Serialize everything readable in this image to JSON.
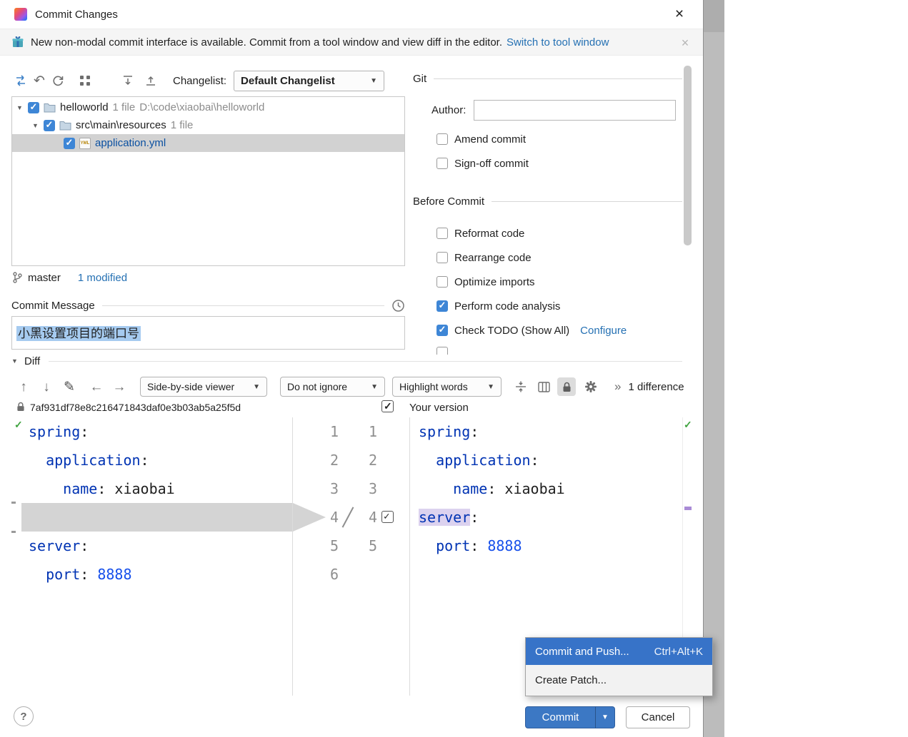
{
  "colors": {
    "accent_blue": "#3C78C4",
    "selection_blue": "#A6CBF0",
    "link_blue": "#2470B3",
    "checkbox_blue": "#3E86D6",
    "modified_file_blue": "#0A50A1",
    "yaml_key": "#0033B3",
    "number_literal": "#1750EB",
    "removed_row_gray": "#D4D4D4",
    "word_highlight_purple": "#DCD2EF",
    "popup_selection": "#3773C8"
  },
  "window": {
    "title": "Commit Changes",
    "close_glyph": "×"
  },
  "banner": {
    "message": "New non-modal commit interface is available. Commit from a tool window and view diff in the editor.",
    "link_label": "Switch to tool window",
    "close_glyph": "×"
  },
  "toolbar": {
    "changelist_label": "Changelist:",
    "changelist_value": "Default Changelist",
    "dropdown_arrow": "▼",
    "revert_glyph": "↶"
  },
  "file_tree": {
    "root": {
      "name": "helloworld",
      "meta": "1 file",
      "path": "D:\\code\\xiaobai\\helloworld",
      "checked": true,
      "twisty": "▼"
    },
    "folder": {
      "name": "src\\main\\resources",
      "meta": "1 file",
      "checked": true,
      "twisty": "▼"
    },
    "file": {
      "name": "application.yml",
      "type": "YML",
      "checked": true
    }
  },
  "vcs_bar": {
    "branch": "master",
    "modified": "1 modified"
  },
  "commit_message": {
    "label": "Commit Message",
    "text": "小黑设置项目的端口号"
  },
  "git_options": {
    "title": "Git",
    "author_label": "Author:",
    "author_value": "",
    "amend": {
      "label": "Amend commit",
      "checked": false
    },
    "signoff": {
      "label": "Sign-off commit",
      "checked": false
    }
  },
  "before_commit": {
    "title": "Before Commit",
    "items": [
      {
        "label": "Reformat code",
        "checked": false
      },
      {
        "label": "Rearrange code",
        "checked": false
      },
      {
        "label": "Optimize imports",
        "checked": false
      },
      {
        "label": "Perform code analysis",
        "checked": true
      },
      {
        "label": "Check TODO (Show All)",
        "checked": true,
        "link": "Configure"
      }
    ]
  },
  "diff": {
    "section_label": "Diff",
    "section_twisty": "▼",
    "nav_up_glyph": "↑",
    "nav_down_glyph": "↓",
    "edit_glyph": "✎",
    "back_glyph": "←",
    "forward_glyph": "→",
    "viewer_select": "Side-by-side viewer",
    "ignore_select": "Do not ignore",
    "highlight_select": "Highlight words",
    "overflow_glyph": "»",
    "difference_count": "1 difference",
    "left_revision": "7af931df78e8c216471843daf0e3b03ab5a25f5d",
    "right_title": "Your version",
    "no_problems_glyph": "✓",
    "left_lines": [
      {
        "tokens": [
          {
            "text": "spring",
            "cls": "key"
          },
          {
            "text": ":",
            "cls": "plain"
          }
        ]
      },
      {
        "tokens": [
          {
            "text": "  application",
            "cls": "key"
          },
          {
            "text": ":",
            "cls": "plain"
          }
        ]
      },
      {
        "tokens": [
          {
            "text": "    name",
            "cls": "key"
          },
          {
            "text": ": ",
            "cls": "plain"
          },
          {
            "text": "xiaobai",
            "cls": "plain"
          }
        ]
      },
      {
        "gap": true,
        "tokens": []
      },
      {
        "tokens": [
          {
            "text": "server",
            "cls": "key"
          },
          {
            "text": ":",
            "cls": "plain"
          }
        ]
      },
      {
        "tokens": [
          {
            "text": "  port",
            "cls": "key"
          },
          {
            "text": ": ",
            "cls": "plain"
          },
          {
            "text": "8888",
            "cls": "num"
          }
        ]
      }
    ],
    "right_lines": [
      {
        "tokens": [
          {
            "text": "spring",
            "cls": "key"
          },
          {
            "text": ":",
            "cls": "plain"
          }
        ]
      },
      {
        "tokens": [
          {
            "text": "  application",
            "cls": "key"
          },
          {
            "text": ":",
            "cls": "plain"
          }
        ]
      },
      {
        "tokens": [
          {
            "text": "    name",
            "cls": "key"
          },
          {
            "text": ": ",
            "cls": "plain"
          },
          {
            "text": "xiaobai",
            "cls": "plain"
          }
        ]
      },
      {
        "tokens": [
          {
            "text": "server",
            "cls": "key",
            "hl": true
          },
          {
            "text": ":",
            "cls": "plain"
          }
        ]
      },
      {
        "tokens": [
          {
            "text": "  port",
            "cls": "key"
          },
          {
            "text": ": ",
            "cls": "plain"
          },
          {
            "text": "8888",
            "cls": "num"
          }
        ]
      }
    ],
    "gutter": [
      {
        "left": "1",
        "right": "1"
      },
      {
        "left": "2",
        "right": "2"
      },
      {
        "left": "3",
        "right": "3"
      },
      {
        "left": "4",
        "right": "4",
        "checkbox": true,
        "slash": true
      },
      {
        "left": "5",
        "right": "5"
      },
      {
        "left": "6",
        "right": ""
      }
    ]
  },
  "commit_menu": {
    "items": [
      {
        "label": "Commit and Push...",
        "shortcut": "Ctrl+Alt+K",
        "selected": true
      },
      {
        "label": "Create Patch...",
        "selected": false
      }
    ]
  },
  "footer": {
    "help_glyph": "?",
    "commit_label": "Commit",
    "commit_arrow": "▼",
    "cancel_label": "Cancel"
  }
}
